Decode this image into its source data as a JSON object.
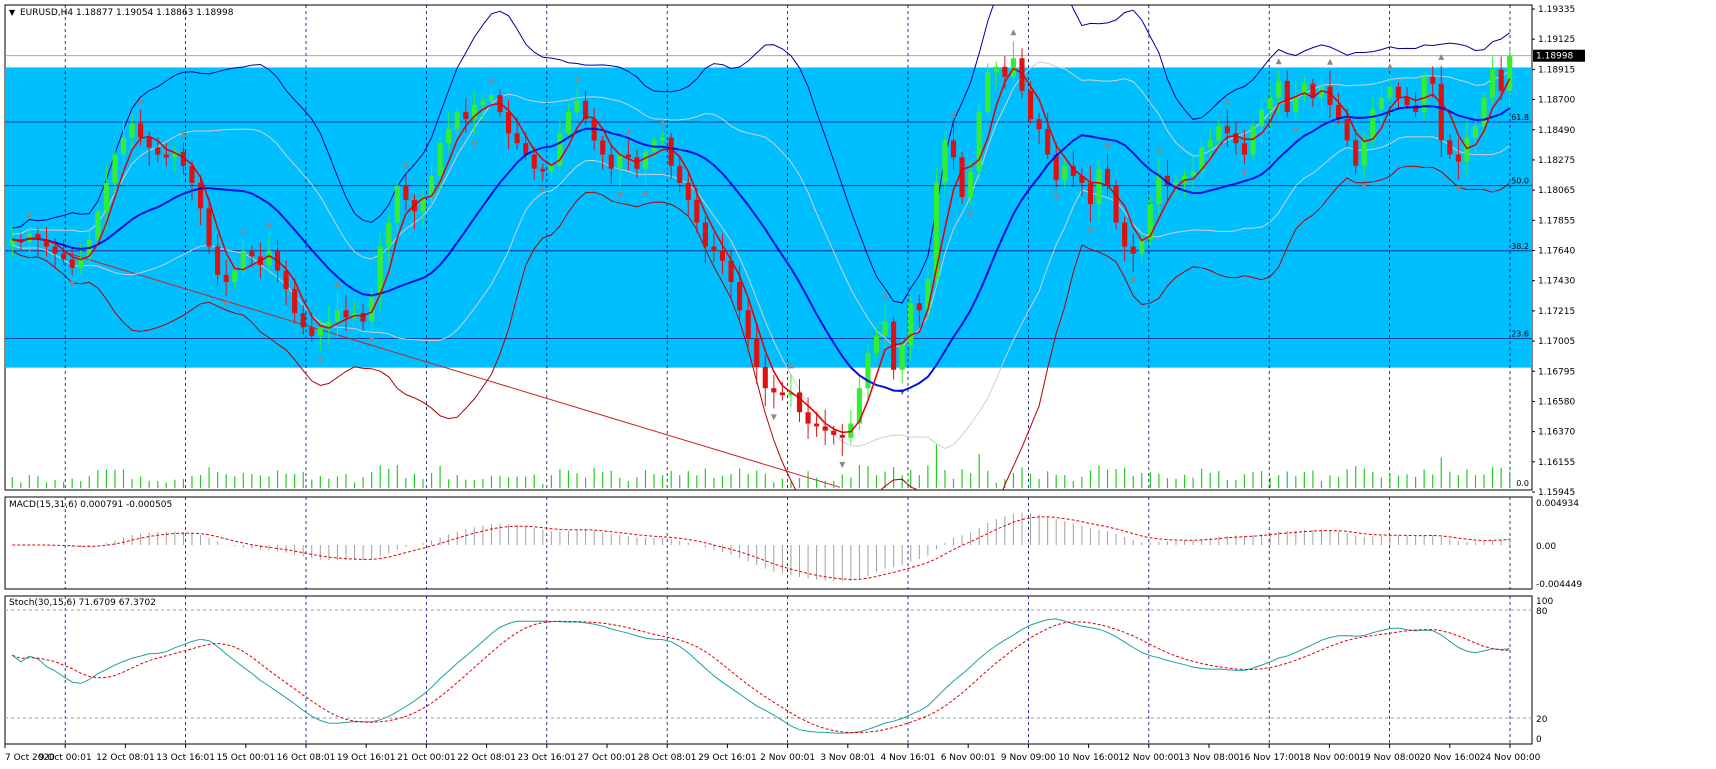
{
  "colors": {
    "zone": "#00BFFF",
    "bull_candle": "#33EE33",
    "bear_candle": "#E01010",
    "ma_fast": "#E00000",
    "ma_slow": "#0010E0",
    "bb_upper": "#0000A0",
    "bb_lower": "#B00000",
    "env": "#D0D0D0",
    "volume": "#22CC22",
    "macd_hist": "#A0A0A0",
    "macd_signal": "#E00000",
    "stoch_main": "#20A0A0",
    "stoch_signal": "#E00000",
    "grid": "#000080",
    "trendline": "#CC2222"
  },
  "main": {
    "header": "EURUSD,H4  1.18877 1.19054 1.18863 1.18998",
    "current_price_label": "1.18998",
    "price_ticks": [
      "1.19335",
      "1.19125",
      "1.18915",
      "1.18700",
      "1.18490",
      "1.18275",
      "1.18065",
      "1.17855",
      "1.17640",
      "1.17430",
      "1.17215",
      "1.17005",
      "1.16795",
      "1.16580",
      "1.16370",
      "1.16155",
      "1.15945"
    ],
    "fib_labels": [
      "61.8",
      "50.0",
      "38.2",
      "23.6",
      "0.0"
    ]
  },
  "macd": {
    "label": "MACD(15,31,6) 0.000791 -0.000505",
    "ticks": [
      "0.004934",
      "0.00",
      "-0.004449"
    ]
  },
  "stoch": {
    "label": "Stoch(30,15,6) 71.6709 67.3702",
    "ticks": [
      "100",
      "80",
      "20",
      "0"
    ]
  },
  "time_axis": [
    "7 Oct 2020",
    "9 Oct 00:01",
    "12 Oct 08:01",
    "13 Oct 16:01",
    "15 Oct 00:01",
    "16 Oct 08:01",
    "19 Oct 16:01",
    "21 Oct 00:01",
    "22 Oct 08:01",
    "23 Oct 16:01",
    "27 Oct 00:01",
    "28 Oct 08:01",
    "29 Oct 16:01",
    "2 Nov 00:01",
    "3 Nov 08:01",
    "4 Nov 16:01",
    "6 Nov 00:01",
    "9 Nov 09:00",
    "10 Nov 16:00",
    "12 Nov 00:00",
    "13 Nov 08:00",
    "16 Nov 17:00",
    "18 Nov 00:00",
    "19 Nov 08:00",
    "20 Nov 16:00",
    "24 Nov 00:00"
  ],
  "chart_data": {
    "type": "candlestick",
    "symbol": "EURUSD",
    "timeframe": "H4",
    "ylim": [
      1.15945,
      1.19335
    ],
    "zone": [
      1.16795,
      1.18915
    ],
    "horizontal_levels": [
      1.18998,
      1.1853,
      1.1808,
      1.1762,
      1.17
    ],
    "close": [
      1.177,
      1.1768,
      1.1774,
      1.177,
      1.1765,
      1.176,
      1.1756,
      1.175,
      1.1757,
      1.177,
      1.179,
      1.181,
      1.183,
      1.1842,
      1.1852,
      1.1842,
      1.1835,
      1.183,
      1.1828,
      1.1832,
      1.1822,
      1.181,
      1.1792,
      1.1765,
      1.1745,
      1.174,
      1.1748,
      1.1762,
      1.1758,
      1.1752,
      1.1762,
      1.1748,
      1.1735,
      1.1718,
      1.1708,
      1.1702,
      1.1708,
      1.1712,
      1.172,
      1.1715,
      1.1718,
      1.1712,
      1.173,
      1.1765,
      1.1782,
      1.1808,
      1.1798,
      1.179,
      1.18,
      1.1815,
      1.1838,
      1.1848,
      1.186,
      1.1855,
      1.1865,
      1.1868,
      1.1872,
      1.186,
      1.1845,
      1.1838,
      1.183,
      1.182,
      1.1818,
      1.1822,
      1.1845,
      1.186,
      1.1868,
      1.1855,
      1.184,
      1.183,
      1.182,
      1.183,
      1.1828,
      1.182,
      1.1832,
      1.184,
      1.1842,
      1.1822,
      1.181,
      1.1798,
      1.1782,
      1.1765,
      1.1762,
      1.1755,
      1.174,
      1.172,
      1.17,
      1.168,
      1.1665,
      1.1662,
      1.166,
      1.1662,
      1.1648,
      1.164,
      1.1638,
      1.1635,
      1.1632,
      1.163,
      1.164,
      1.1665,
      1.169,
      1.1702,
      1.1712,
      1.1678,
      1.1695,
      1.1725,
      1.172,
      1.1742,
      1.181,
      1.184,
      1.1828,
      1.18,
      1.1818,
      1.186,
      1.1888,
      1.1892,
      1.1885,
      1.1898,
      1.1875,
      1.1855,
      1.1848,
      1.183,
      1.1812,
      1.1822,
      1.1815,
      1.181,
      1.1795,
      1.182,
      1.1808,
      1.1782,
      1.1765,
      1.176,
      1.177,
      1.1795,
      1.1815,
      1.1808,
      1.181,
      1.1815,
      1.1818,
      1.1835,
      1.184,
      1.185,
      1.1845,
      1.1838,
      1.183,
      1.185,
      1.1862,
      1.187,
      1.1882,
      1.186,
      1.1872,
      1.188,
      1.187,
      1.1878,
      1.1865,
      1.1855,
      1.184,
      1.1822,
      1.184,
      1.1862,
      1.187,
      1.1878,
      1.187,
      1.1865,
      1.186,
      1.1885,
      1.188,
      1.184,
      1.183,
      1.1825,
      1.1842,
      1.185,
      1.187,
      1.189,
      1.1875,
      1.18998
    ]
  }
}
